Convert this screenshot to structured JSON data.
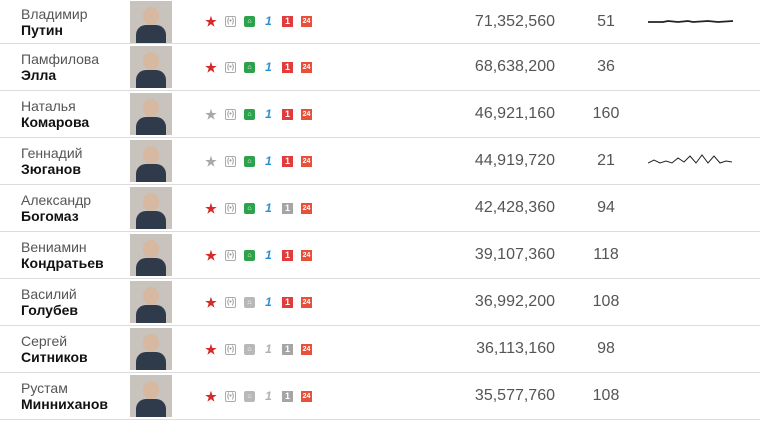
{
  "rows": [
    {
      "first": "Владимир",
      "last": "Путин",
      "value": "71,352,560",
      "count": "51",
      "star": "red",
      "tv1": "green",
      "tv2": "blue",
      "tv3": "red",
      "spark": "flat"
    },
    {
      "first": "Памфилова",
      "last": "Элла",
      "value": "68,638,200",
      "count": "36",
      "star": "red",
      "tv1": "green",
      "tv2": "blue",
      "tv3": "red",
      "spark": ""
    },
    {
      "first": "Наталья",
      "last": "Комарова",
      "value": "46,921,160",
      "count": "160",
      "star": "grey",
      "tv1": "green",
      "tv2": "blue",
      "tv3": "red",
      "spark": ""
    },
    {
      "first": "Геннадий",
      "last": "Зюганов",
      "value": "44,919,720",
      "count": "21",
      "star": "grey",
      "tv1": "green",
      "tv2": "blue",
      "tv3": "red",
      "spark": "zigzag"
    },
    {
      "first": "Александр",
      "last": "Богомаз",
      "value": "42,428,360",
      "count": "94",
      "star": "red",
      "tv1": "green",
      "tv2": "blue",
      "tv3": "grey",
      "spark": ""
    },
    {
      "first": "Вениамин",
      "last": "Кондратьев",
      "value": "39,107,360",
      "count": "118",
      "star": "red",
      "tv1": "green",
      "tv2": "blue",
      "tv3": "red",
      "spark": ""
    },
    {
      "first": "Василий",
      "last": "Голубев",
      "value": "36,992,200",
      "count": "108",
      "star": "red",
      "tv1": "grey",
      "tv2": "blue",
      "tv3": "red",
      "spark": ""
    },
    {
      "first": "Сергей",
      "last": "Ситников",
      "value": "36,113,160",
      "count": "98",
      "star": "red",
      "tv1": "grey",
      "tv2": "grey",
      "tv3": "grey",
      "spark": ""
    },
    {
      "first": "Рустам",
      "last": "Минниханов",
      "value": "35,577,760",
      "count": "108",
      "star": "red",
      "tv1": "grey",
      "tv2": "grey",
      "tv3": "grey",
      "spark": ""
    }
  ],
  "icon_labels": {
    "radio": "(•)",
    "tv1": "⌂",
    "tv2": "1",
    "tv3": "1",
    "tv4": "24"
  },
  "colors": {
    "accent_red": "#d42a2a",
    "green": "#2ca24a",
    "blue": "#2c8fd1",
    "grey": "#a8a8a8"
  }
}
